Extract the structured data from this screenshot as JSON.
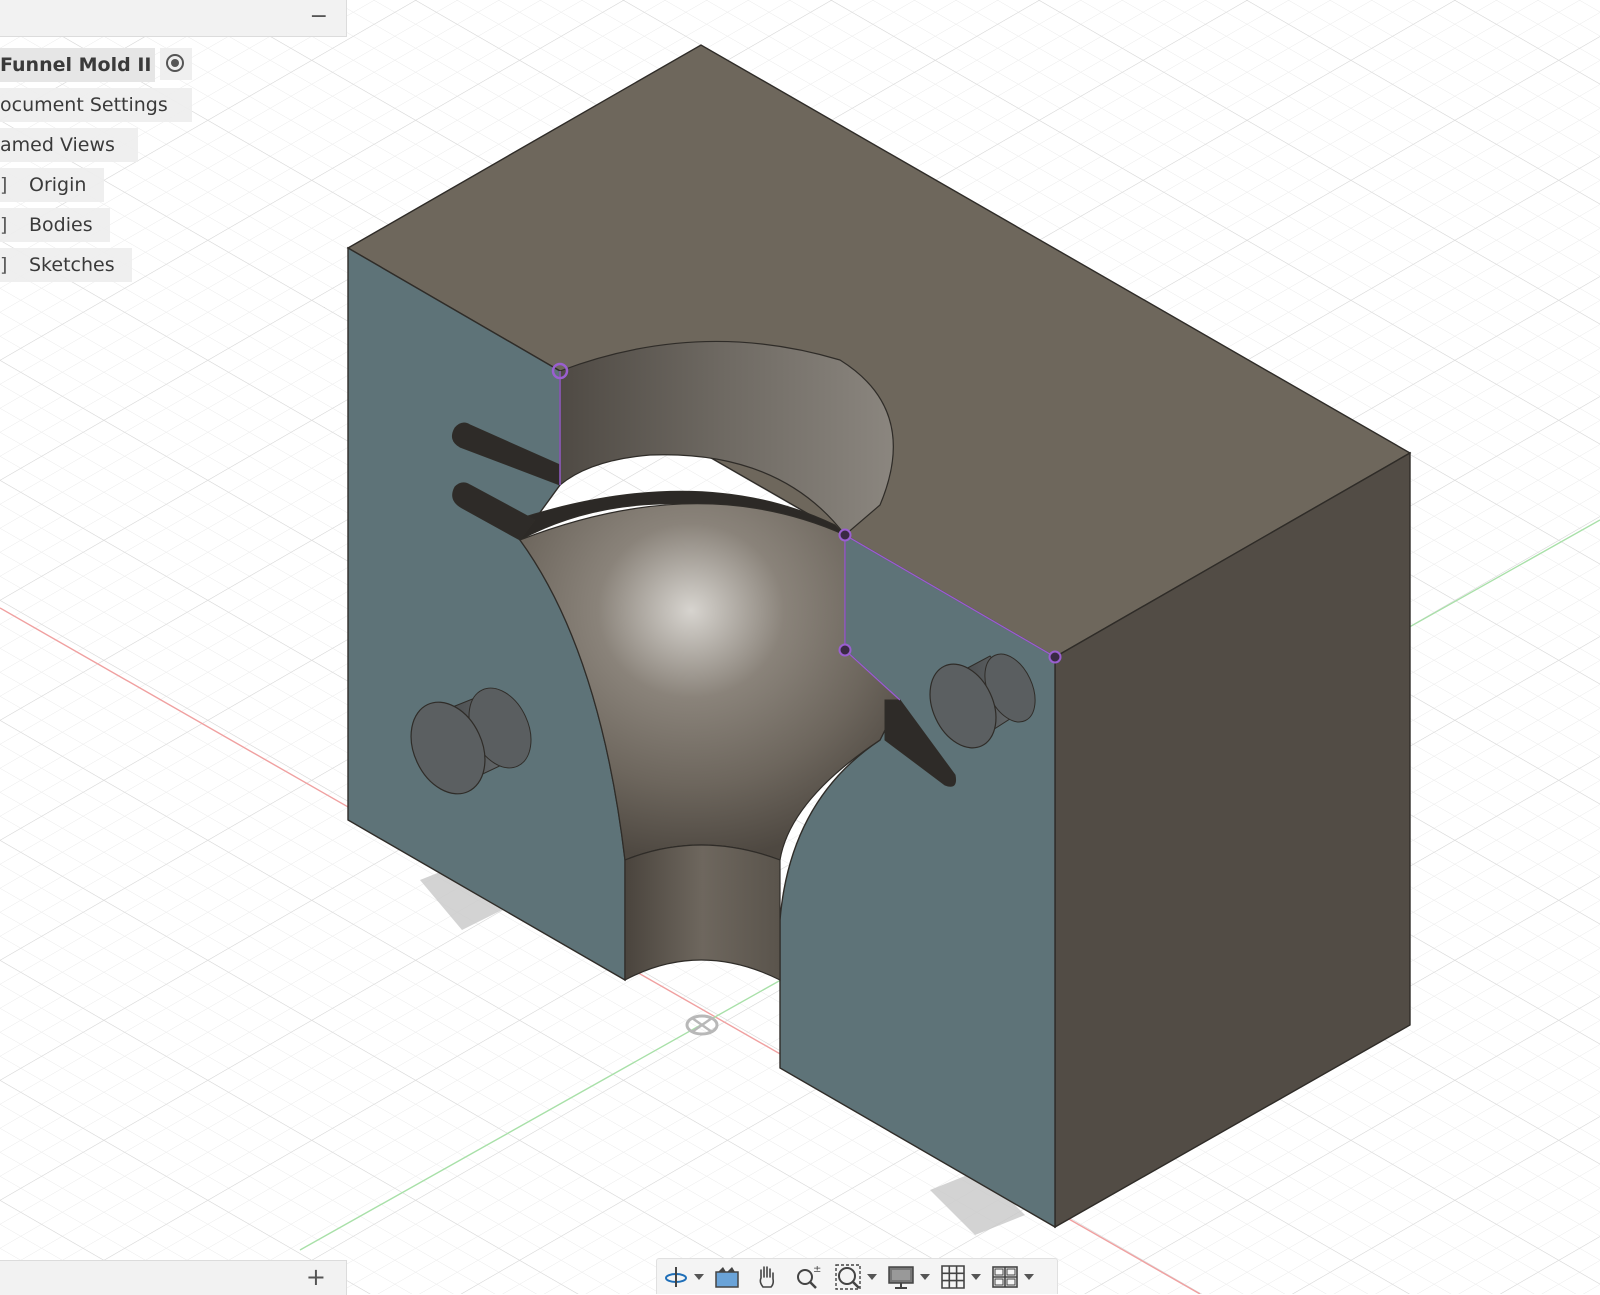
{
  "browser": {
    "collapse_label": "−",
    "document_name": "Funnel Mold II",
    "items": [
      {
        "label": "ocument Settings",
        "bracket": ""
      },
      {
        "label": "amed Views",
        "bracket": ""
      },
      {
        "label": "Origin",
        "bracket": "]"
      },
      {
        "label": "Bodies",
        "bracket": "]"
      },
      {
        "label": "Sketches",
        "bracket": "]"
      }
    ]
  },
  "comments": {
    "add_label": "+"
  },
  "navbar": {
    "tools": [
      "orbit-icon",
      "look-at-icon",
      "pan-icon",
      "zoom-icon",
      "fit-icon",
      "display-settings-icon",
      "grid-settings-icon",
      "viewports-icon"
    ]
  },
  "colors": {
    "top_face": "#6e675c",
    "front_face": "#5e7378",
    "right_face": "#524c45",
    "sketch_line": "#9a5fd0",
    "x_axis": "#f0a0a0",
    "y_axis": "#a8e0a8"
  }
}
